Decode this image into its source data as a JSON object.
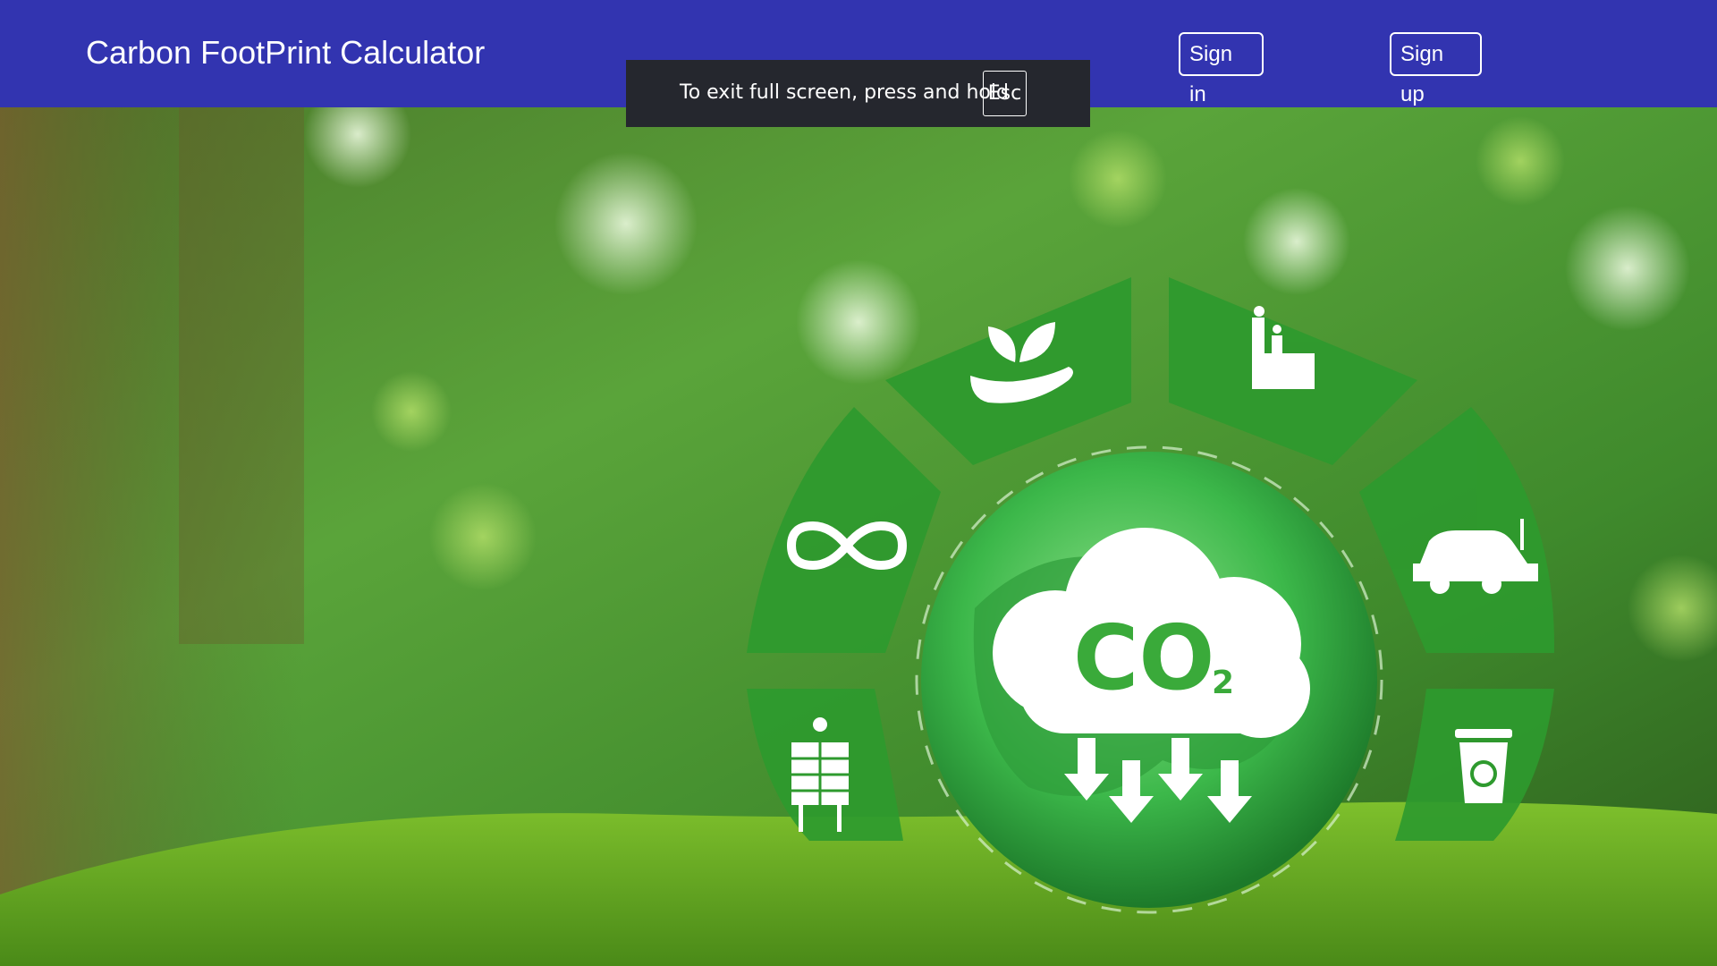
{
  "navbar": {
    "brand": "Carbon FootPrint Calculator",
    "sign_in_label": "Sign in",
    "sign_up_label": "Sign up",
    "background": "#3234b0"
  },
  "fullscreen_toast": {
    "message": "To exit full screen, press and hold",
    "key": "Esc"
  },
  "hero": {
    "co2_label": "CO",
    "co2_subscript": "2",
    "accent": "#2e9a2e",
    "icons": [
      "plant-hand-icon",
      "factory-icon",
      "infinity-recycle-icon",
      "electric-car-icon",
      "solar-panel-icon",
      "recycle-bin-icon"
    ]
  }
}
